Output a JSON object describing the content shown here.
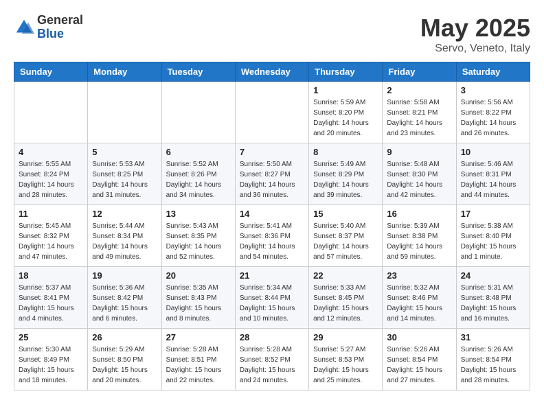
{
  "header": {
    "logo_general": "General",
    "logo_blue": "Blue",
    "title": "May 2025",
    "subtitle": "Servo, Veneto, Italy"
  },
  "weekdays": [
    "Sunday",
    "Monday",
    "Tuesday",
    "Wednesday",
    "Thursday",
    "Friday",
    "Saturday"
  ],
  "weeks": [
    [
      {
        "day": "",
        "sunrise": "",
        "sunset": "",
        "daylight": ""
      },
      {
        "day": "",
        "sunrise": "",
        "sunset": "",
        "daylight": ""
      },
      {
        "day": "",
        "sunrise": "",
        "sunset": "",
        "daylight": ""
      },
      {
        "day": "",
        "sunrise": "",
        "sunset": "",
        "daylight": ""
      },
      {
        "day": "1",
        "sunrise": "Sunrise: 5:59 AM",
        "sunset": "Sunset: 8:20 PM",
        "daylight": "Daylight: 14 hours and 20 minutes."
      },
      {
        "day": "2",
        "sunrise": "Sunrise: 5:58 AM",
        "sunset": "Sunset: 8:21 PM",
        "daylight": "Daylight: 14 hours and 23 minutes."
      },
      {
        "day": "3",
        "sunrise": "Sunrise: 5:56 AM",
        "sunset": "Sunset: 8:22 PM",
        "daylight": "Daylight: 14 hours and 26 minutes."
      }
    ],
    [
      {
        "day": "4",
        "sunrise": "Sunrise: 5:55 AM",
        "sunset": "Sunset: 8:24 PM",
        "daylight": "Daylight: 14 hours and 28 minutes."
      },
      {
        "day": "5",
        "sunrise": "Sunrise: 5:53 AM",
        "sunset": "Sunset: 8:25 PM",
        "daylight": "Daylight: 14 hours and 31 minutes."
      },
      {
        "day": "6",
        "sunrise": "Sunrise: 5:52 AM",
        "sunset": "Sunset: 8:26 PM",
        "daylight": "Daylight: 14 hours and 34 minutes."
      },
      {
        "day": "7",
        "sunrise": "Sunrise: 5:50 AM",
        "sunset": "Sunset: 8:27 PM",
        "daylight": "Daylight: 14 hours and 36 minutes."
      },
      {
        "day": "8",
        "sunrise": "Sunrise: 5:49 AM",
        "sunset": "Sunset: 8:29 PM",
        "daylight": "Daylight: 14 hours and 39 minutes."
      },
      {
        "day": "9",
        "sunrise": "Sunrise: 5:48 AM",
        "sunset": "Sunset: 8:30 PM",
        "daylight": "Daylight: 14 hours and 42 minutes."
      },
      {
        "day": "10",
        "sunrise": "Sunrise: 5:46 AM",
        "sunset": "Sunset: 8:31 PM",
        "daylight": "Daylight: 14 hours and 44 minutes."
      }
    ],
    [
      {
        "day": "11",
        "sunrise": "Sunrise: 5:45 AM",
        "sunset": "Sunset: 8:32 PM",
        "daylight": "Daylight: 14 hours and 47 minutes."
      },
      {
        "day": "12",
        "sunrise": "Sunrise: 5:44 AM",
        "sunset": "Sunset: 8:34 PM",
        "daylight": "Daylight: 14 hours and 49 minutes."
      },
      {
        "day": "13",
        "sunrise": "Sunrise: 5:43 AM",
        "sunset": "Sunset: 8:35 PM",
        "daylight": "Daylight: 14 hours and 52 minutes."
      },
      {
        "day": "14",
        "sunrise": "Sunrise: 5:41 AM",
        "sunset": "Sunset: 8:36 PM",
        "daylight": "Daylight: 14 hours and 54 minutes."
      },
      {
        "day": "15",
        "sunrise": "Sunrise: 5:40 AM",
        "sunset": "Sunset: 8:37 PM",
        "daylight": "Daylight: 14 hours and 57 minutes."
      },
      {
        "day": "16",
        "sunrise": "Sunrise: 5:39 AM",
        "sunset": "Sunset: 8:38 PM",
        "daylight": "Daylight: 14 hours and 59 minutes."
      },
      {
        "day": "17",
        "sunrise": "Sunrise: 5:38 AM",
        "sunset": "Sunset: 8:40 PM",
        "daylight": "Daylight: 15 hours and 1 minute."
      }
    ],
    [
      {
        "day": "18",
        "sunrise": "Sunrise: 5:37 AM",
        "sunset": "Sunset: 8:41 PM",
        "daylight": "Daylight: 15 hours and 4 minutes."
      },
      {
        "day": "19",
        "sunrise": "Sunrise: 5:36 AM",
        "sunset": "Sunset: 8:42 PM",
        "daylight": "Daylight: 15 hours and 6 minutes."
      },
      {
        "day": "20",
        "sunrise": "Sunrise: 5:35 AM",
        "sunset": "Sunset: 8:43 PM",
        "daylight": "Daylight: 15 hours and 8 minutes."
      },
      {
        "day": "21",
        "sunrise": "Sunrise: 5:34 AM",
        "sunset": "Sunset: 8:44 PM",
        "daylight": "Daylight: 15 hours and 10 minutes."
      },
      {
        "day": "22",
        "sunrise": "Sunrise: 5:33 AM",
        "sunset": "Sunset: 8:45 PM",
        "daylight": "Daylight: 15 hours and 12 minutes."
      },
      {
        "day": "23",
        "sunrise": "Sunrise: 5:32 AM",
        "sunset": "Sunset: 8:46 PM",
        "daylight": "Daylight: 15 hours and 14 minutes."
      },
      {
        "day": "24",
        "sunrise": "Sunrise: 5:31 AM",
        "sunset": "Sunset: 8:48 PM",
        "daylight": "Daylight: 15 hours and 16 minutes."
      }
    ],
    [
      {
        "day": "25",
        "sunrise": "Sunrise: 5:30 AM",
        "sunset": "Sunset: 8:49 PM",
        "daylight": "Daylight: 15 hours and 18 minutes."
      },
      {
        "day": "26",
        "sunrise": "Sunrise: 5:29 AM",
        "sunset": "Sunset: 8:50 PM",
        "daylight": "Daylight: 15 hours and 20 minutes."
      },
      {
        "day": "27",
        "sunrise": "Sunrise: 5:28 AM",
        "sunset": "Sunset: 8:51 PM",
        "daylight": "Daylight: 15 hours and 22 minutes."
      },
      {
        "day": "28",
        "sunrise": "Sunrise: 5:28 AM",
        "sunset": "Sunset: 8:52 PM",
        "daylight": "Daylight: 15 hours and 24 minutes."
      },
      {
        "day": "29",
        "sunrise": "Sunrise: 5:27 AM",
        "sunset": "Sunset: 8:53 PM",
        "daylight": "Daylight: 15 hours and 25 minutes."
      },
      {
        "day": "30",
        "sunrise": "Sunrise: 5:26 AM",
        "sunset": "Sunset: 8:54 PM",
        "daylight": "Daylight: 15 hours and 27 minutes."
      },
      {
        "day": "31",
        "sunrise": "Sunrise: 5:26 AM",
        "sunset": "Sunset: 8:54 PM",
        "daylight": "Daylight: 15 hours and 28 minutes."
      }
    ]
  ]
}
